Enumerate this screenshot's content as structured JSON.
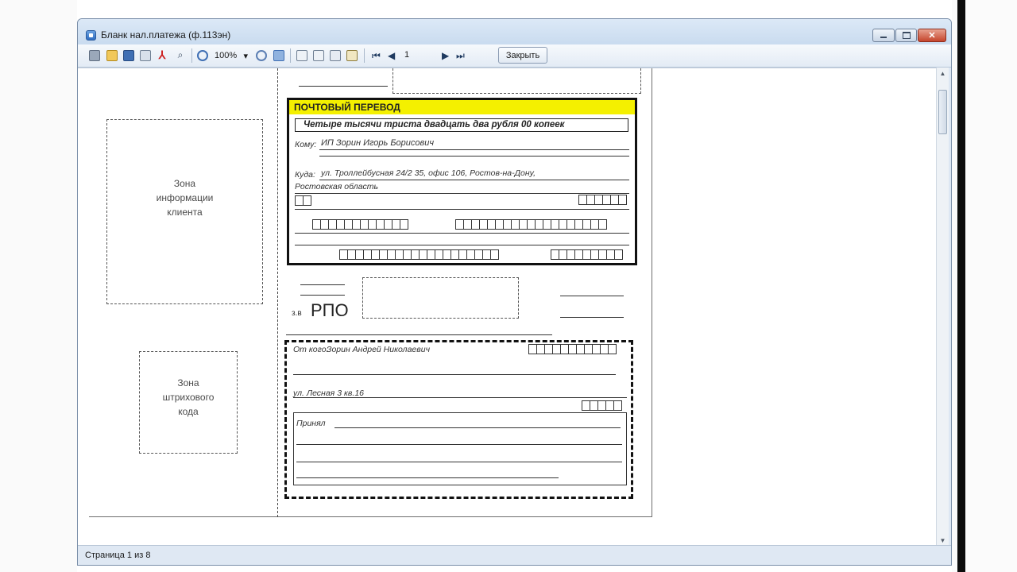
{
  "window": {
    "title": "Бланк нал.платежа (ф.113эн)"
  },
  "toolbar": {
    "zoom": "100%",
    "page_number": "1",
    "close_label": "Закрыть"
  },
  "statusbar": {
    "page_info": "Страница 1 из 8"
  },
  "document": {
    "zone_info_line1": "Зона",
    "zone_info_line2": "информации",
    "zone_info_line3": "клиента",
    "zone_code_line1": "Зона",
    "zone_code_line2": "штрихового",
    "zone_code_line3": "кода",
    "postal_title": "ПОЧТОВЫЙ ПЕРЕВОД",
    "amount_words": "Четыре тысячи триста двадцать два рубля 00 копеек",
    "to_label": "Кому:",
    "recipient": "ИП Зорин Игорь Борисович",
    "where_label": "Куда:",
    "address_line1": "ул. Троллейбусная 24/2 35, офис 106, Ростов-на-Дону,",
    "address_line2": "Ростовская область",
    "rpo_prefix": "з.в",
    "rpo": "РПО",
    "from_label": "От кого:",
    "sender": "Зорин Андрей Николаевич",
    "sender_address": "ул. Лесная 3 кв.16",
    "received_label": "Принял"
  }
}
